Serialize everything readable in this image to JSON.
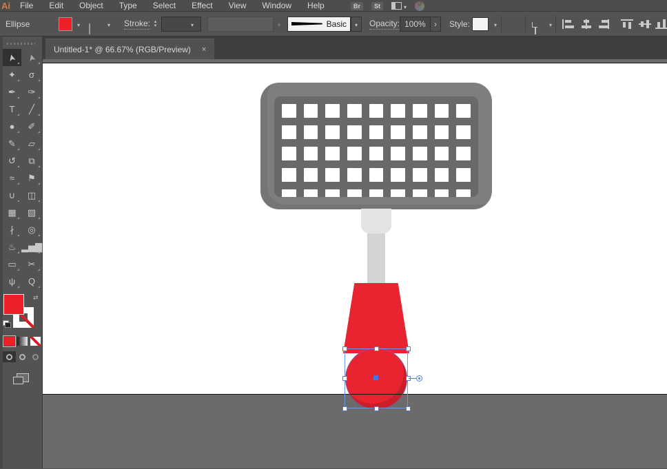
{
  "app": {
    "logo": "Ai"
  },
  "menu_bar": {
    "items": [
      "File",
      "Edit",
      "Object",
      "Type",
      "Select",
      "Effect",
      "View",
      "Window",
      "Help"
    ],
    "bridge_label": "Br",
    "stock_label": "St"
  },
  "control_bar": {
    "context_label": "Ellipse",
    "stroke_label": "Stroke:",
    "brush_style": "Basic",
    "opacity_label": "Opacity:",
    "opacity_value": "100%",
    "style_label": "Style:"
  },
  "tab_bar": {
    "title": "Untitled-1* @ 66.67% (RGB/Preview)",
    "close_glyph": "×"
  },
  "toolbar": {
    "active_tool": "selection-tool",
    "tools": [
      {
        "name": "selection-tool",
        "glyph": "➤",
        "active": true
      },
      {
        "name": "direct-selection-tool",
        "glyph": "➤"
      },
      {
        "name": "magic-wand-tool",
        "glyph": "✦"
      },
      {
        "name": "lasso-tool",
        "glyph": "σ"
      },
      {
        "name": "pen-tool",
        "glyph": "✒"
      },
      {
        "name": "curvature-tool",
        "glyph": "✑"
      },
      {
        "name": "type-tool",
        "glyph": "T"
      },
      {
        "name": "line-segment-tool",
        "glyph": "╱"
      },
      {
        "name": "ellipse-tool",
        "glyph": "●"
      },
      {
        "name": "paintbrush-tool",
        "glyph": "✐"
      },
      {
        "name": "pencil-tool",
        "glyph": "✎"
      },
      {
        "name": "eraser-tool",
        "glyph": "▱"
      },
      {
        "name": "rotate-tool",
        "glyph": "↺"
      },
      {
        "name": "scale-tool",
        "glyph": "⧉"
      },
      {
        "name": "width-tool",
        "glyph": "≈"
      },
      {
        "name": "puppet-warp-tool",
        "glyph": "⚑"
      },
      {
        "name": "shape-builder-tool",
        "glyph": "∪"
      },
      {
        "name": "perspective-grid-tool",
        "glyph": "◫"
      },
      {
        "name": "mesh-tool",
        "glyph": "▦"
      },
      {
        "name": "gradient-tool",
        "glyph": "▧"
      },
      {
        "name": "eyedropper-tool",
        "glyph": "∤"
      },
      {
        "name": "blend-tool",
        "glyph": "◎"
      },
      {
        "name": "symbol-sprayer-tool",
        "glyph": "♨"
      },
      {
        "name": "column-graph-tool",
        "glyph": "▂▅▇"
      },
      {
        "name": "artboard-tool",
        "glyph": "▭"
      },
      {
        "name": "slice-tool",
        "glyph": "✂"
      },
      {
        "name": "hand-tool",
        "glyph": "ψ"
      },
      {
        "name": "zoom-tool",
        "glyph": "Q"
      }
    ]
  },
  "artwork": {
    "grid_holes_columns": 9,
    "grid_holes_rows": 5,
    "selection_handle_count": 8
  },
  "colors": {
    "fill_red": "#ed1f28",
    "artwork_red": "#e82430",
    "head_gray": "#7e7e7e",
    "grid_gray": "#696969",
    "shaft_gray": "#d4d4d4",
    "connector_gray": "#e3e3e3",
    "pasteboard_gray": "#6b6b6b",
    "selection_accent": "#4d7fe3"
  }
}
